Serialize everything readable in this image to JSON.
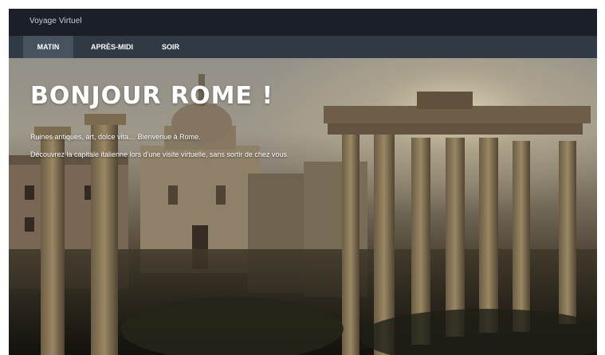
{
  "app": {
    "title": "Voyage Virtuel"
  },
  "tabs": [
    {
      "label": "MATIN",
      "active": true
    },
    {
      "label": "APRÈS-MIDI",
      "active": false
    },
    {
      "label": "SOIR",
      "active": false
    }
  ],
  "hero": {
    "title": "BONJOUR ROME !",
    "line1": "Ruines antiques, art, dolce vita… Bienvenue à Rome.",
    "line2": "Découvrez la capitale italienne lors d'une visite virtuelle, sans sortir de chez vous."
  },
  "colors": {
    "titlebar": "#1b2028",
    "tabbar": "#303a45",
    "tab_active": "#46525e",
    "text": "#ffffff"
  }
}
